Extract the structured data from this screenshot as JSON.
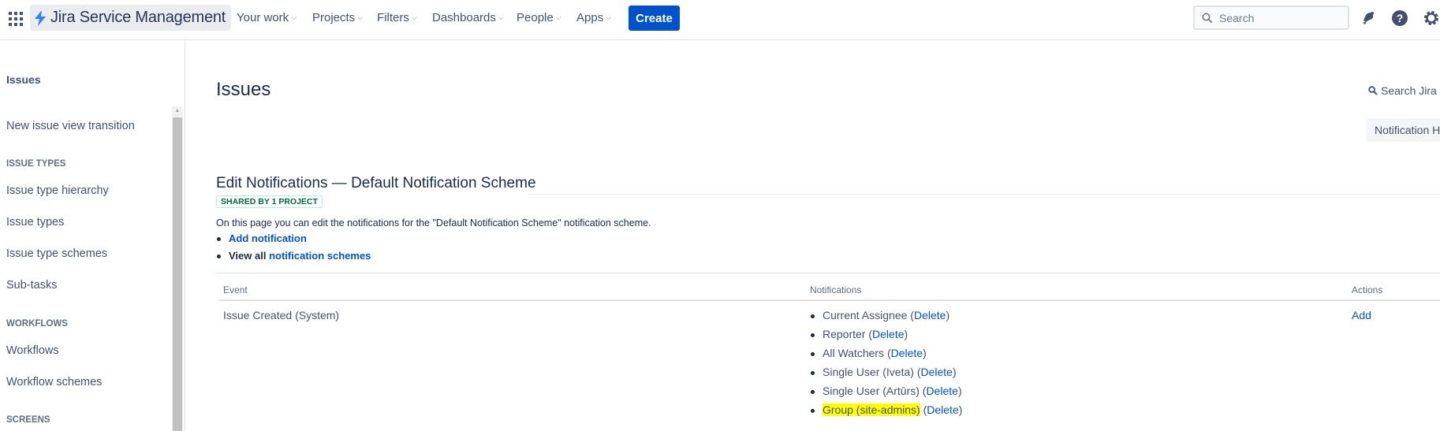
{
  "topnav": {
    "product": "Jira Service Management",
    "items": [
      {
        "label": "Your work"
      },
      {
        "label": "Projects"
      },
      {
        "label": "Filters"
      },
      {
        "label": "Dashboards"
      },
      {
        "label": "People"
      },
      {
        "label": "Apps"
      }
    ],
    "create_label": "Create",
    "search_placeholder": "Search",
    "icons": [
      "app-switcher-icon",
      "notifications-icon",
      "help-icon",
      "settings-icon"
    ]
  },
  "sidebar": {
    "heading": "Issues",
    "top_item": "New issue view transition",
    "sections": [
      {
        "title": "ISSUE TYPES",
        "items": [
          "Issue type hierarchy",
          "Issue types",
          "Issue type schemes",
          "Sub-tasks"
        ]
      },
      {
        "title": "WORKFLOWS",
        "items": [
          "Workflows",
          "Workflow schemes"
        ]
      },
      {
        "title": "SCREENS",
        "items": []
      }
    ]
  },
  "main": {
    "title": "Issues",
    "jira_search_label": "Search Jira a",
    "notification_helper_label": "Notification H",
    "scheme_title": "Edit Notifications — Default Notification Scheme",
    "shared_badge": "SHARED BY 1 PROJECT",
    "description": "On this page you can edit the notifications for the \"Default Notification Scheme\" notification scheme.",
    "add_notification_label": "Add notification",
    "view_all_prefix": "View all",
    "view_all_link": "notification schemes",
    "table": {
      "headers": {
        "event": "Event",
        "notifications": "Notifications",
        "actions": "Actions"
      },
      "rows": [
        {
          "event": "Issue Created",
          "event_suffix": "(System)",
          "notifications": [
            {
              "name": "Current Assignee",
              "delete": "Delete",
              "highlighted": false
            },
            {
              "name": "Reporter",
              "delete": "Delete",
              "highlighted": false
            },
            {
              "name": "All Watchers",
              "delete": "Delete",
              "highlighted": false
            },
            {
              "name": "Single User (Iveta)",
              "delete": "Delete",
              "highlighted": false
            },
            {
              "name": "Single User (Artūrs)",
              "delete": "Delete",
              "highlighted": false
            },
            {
              "name": "Group (site-admins)",
              "delete": "Delete",
              "highlighted": true
            }
          ],
          "action": "Add"
        }
      ]
    }
  },
  "colors": {
    "accent": "#0052cc",
    "text": "#172b4d",
    "highlight": "#ffff00",
    "lozenge_text": "#006644"
  }
}
